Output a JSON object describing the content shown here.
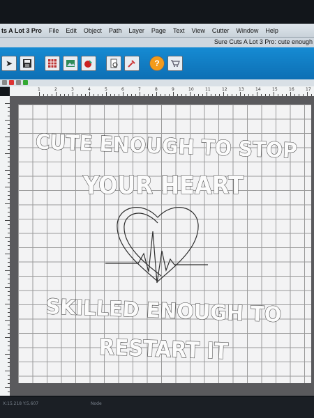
{
  "app": {
    "name_fragment": "ts A Lot 3 Pro",
    "window_title": "Sure Cuts A Lot 3 Pro: cute enough"
  },
  "menu": [
    "File",
    "Edit",
    "Object",
    "Path",
    "Layer",
    "Page",
    "Text",
    "View",
    "Cutter",
    "Window",
    "Help"
  ],
  "toolbar": {
    "icons": [
      "arrow-icon",
      "save-icon",
      "grid-icon",
      "image-icon",
      "paint-icon",
      "document-icon",
      "tools-icon",
      "help-icon",
      "cart-icon"
    ]
  },
  "ruler": {
    "top_labels": [
      "1",
      "2",
      "3",
      "4",
      "5",
      "6",
      "7",
      "8",
      "9",
      "10",
      "11",
      "12",
      "13",
      "14",
      "15",
      "16",
      "17"
    ]
  },
  "design": {
    "line1": "CUTE ENOUGH TO STOP",
    "line2": "YOUR HEART",
    "line3": "SKILLED ENOUGH TO",
    "line4": "RESTART IT"
  },
  "status": {
    "coords": "X:15.218  Y:5.607",
    "mode": "Node"
  }
}
